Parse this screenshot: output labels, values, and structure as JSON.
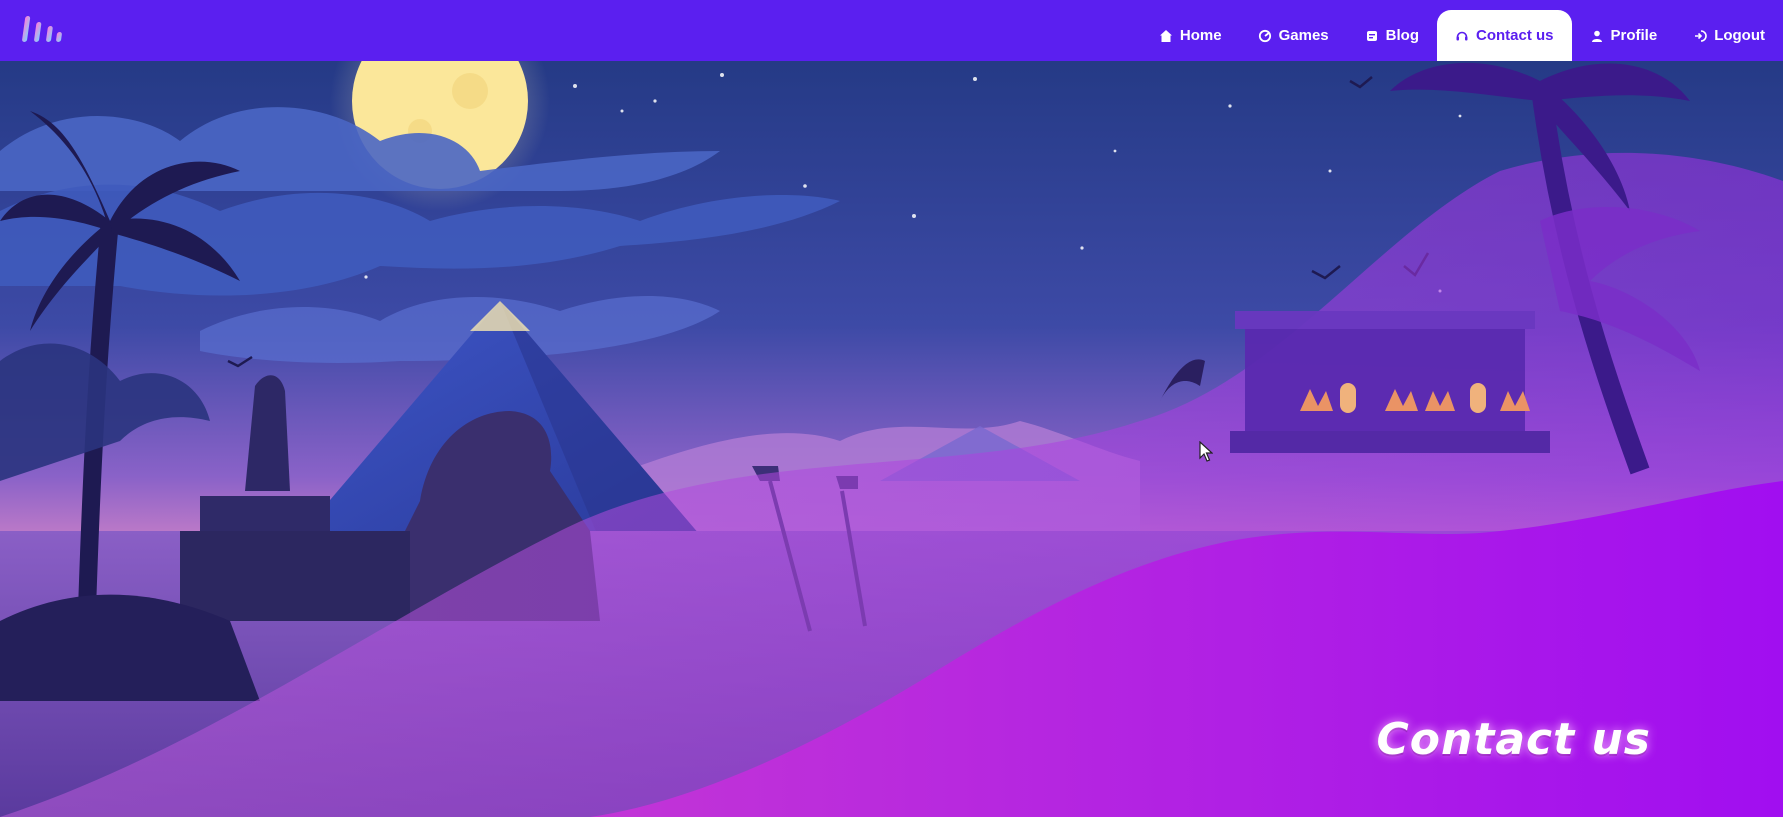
{
  "nav": {
    "items": [
      {
        "label": "Home",
        "icon": "home-icon",
        "active": false
      },
      {
        "label": "Games",
        "icon": "games-icon",
        "active": false
      },
      {
        "label": "Blog",
        "icon": "blog-icon",
        "active": false
      },
      {
        "label": "Contact us",
        "icon": "headset-icon",
        "active": true
      },
      {
        "label": "Profile",
        "icon": "user-icon",
        "active": false
      },
      {
        "label": "Logout",
        "icon": "logout-icon",
        "active": false
      }
    ]
  },
  "hero": {
    "title": "Contact us"
  },
  "colors": {
    "navbar": "#5b1ff0",
    "active_text": "#5b1ff0",
    "wave_purple": "#b41ee8",
    "wave_light": "#c24ce6"
  }
}
